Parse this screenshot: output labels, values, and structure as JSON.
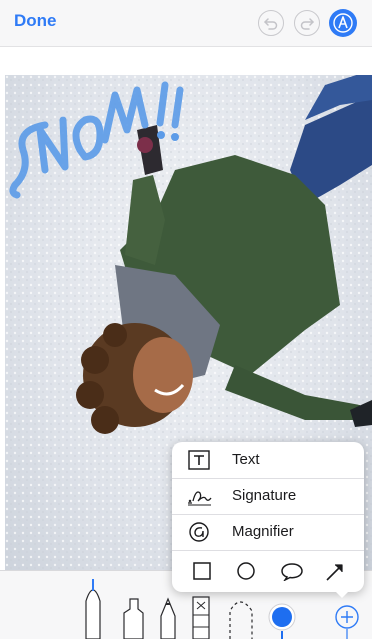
{
  "topbar": {
    "done_label": "Done",
    "undo_icon": "undo-icon",
    "redo_icon": "redo-icon",
    "markup_icon": "markup-pen-icon",
    "accent": "#2f7bf6"
  },
  "photo": {
    "handwritten_text": "SNOW!!",
    "ink_color": "#5b9be8"
  },
  "popover": {
    "items": [
      {
        "label": "Text",
        "icon": "text-box-icon"
      },
      {
        "label": "Signature",
        "icon": "signature-icon"
      },
      {
        "label": "Magnifier",
        "icon": "magnifier-icon"
      }
    ],
    "shapes": [
      "square-icon",
      "circle-icon",
      "speech-bubble-icon",
      "arrow-icon"
    ]
  },
  "toolbar": {
    "tools": [
      "pen-icon",
      "marker-icon",
      "pencil-icon",
      "eraser-icon",
      "lasso-icon"
    ],
    "selected_color": "#1e6ef0",
    "add_icon": "plus-icon"
  }
}
